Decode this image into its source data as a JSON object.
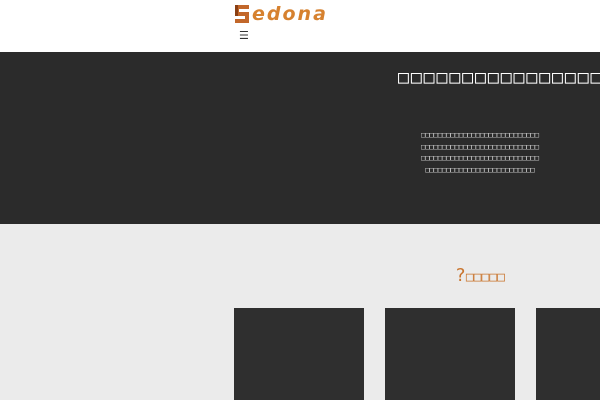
{
  "brand": {
    "name": "edona",
    "accent_color": "#d6812f"
  },
  "nav": {
    "menu_icon": "☰"
  },
  "hero": {
    "title": "□□□□□□□□□□□□□□□□",
    "body": "□□□□□□□□□□□□□□□□□□□□□□□□□□□□□□□□□□□□□□□□□□□□□□□□□□□□□□□□□□□□□□□□□□□□□□□□□□□□□□□□□□□□□□□□□□□□□□□□□□□□□□□□□□□□□□"
  },
  "section": {
    "title_first": "?",
    "title_rest": "□□□□□"
  },
  "cards": [
    {
      "label": ""
    },
    {
      "label": ""
    },
    {
      "label": ""
    }
  ]
}
